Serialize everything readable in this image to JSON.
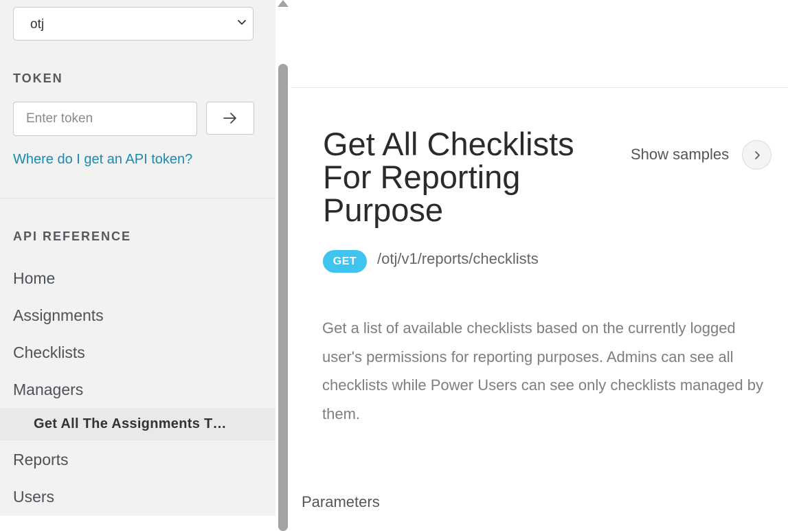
{
  "sidebar": {
    "version_select": {
      "value": "otj"
    },
    "token_section": {
      "label": "TOKEN",
      "input_placeholder": "Enter token",
      "help_link": "Where do I get an API token?"
    },
    "api_reference": {
      "label": "API REFERENCE",
      "items": [
        {
          "label": "Home"
        },
        {
          "label": "Assignments"
        },
        {
          "label": "Checklists"
        },
        {
          "label": "Managers"
        },
        {
          "label": "Get All The Assignments T…",
          "sub": true,
          "active": true
        },
        {
          "label": "Reports"
        },
        {
          "label": "Users"
        }
      ]
    }
  },
  "main": {
    "title": "Get All Checklists For Reporting Purpose",
    "show_samples_label": "Show samples",
    "method": "GET",
    "path": "/otj/v1/reports/checklists",
    "description": "Get a list of available checklists based on the currently logged user's permissions for reporting purposes. Admins can see all checklists while Power Users can see only checklists managed by them.",
    "parameters_heading": "Parameters"
  },
  "icons": {
    "select_chevron": "chevron-down-icon",
    "token_submit": "arrow-right-icon",
    "show_samples": "chevron-right-icon"
  },
  "colors": {
    "method_badge": "#3fc4ef",
    "link": "#1a8ab0",
    "sidebar_bg": "#f2f2f2"
  }
}
